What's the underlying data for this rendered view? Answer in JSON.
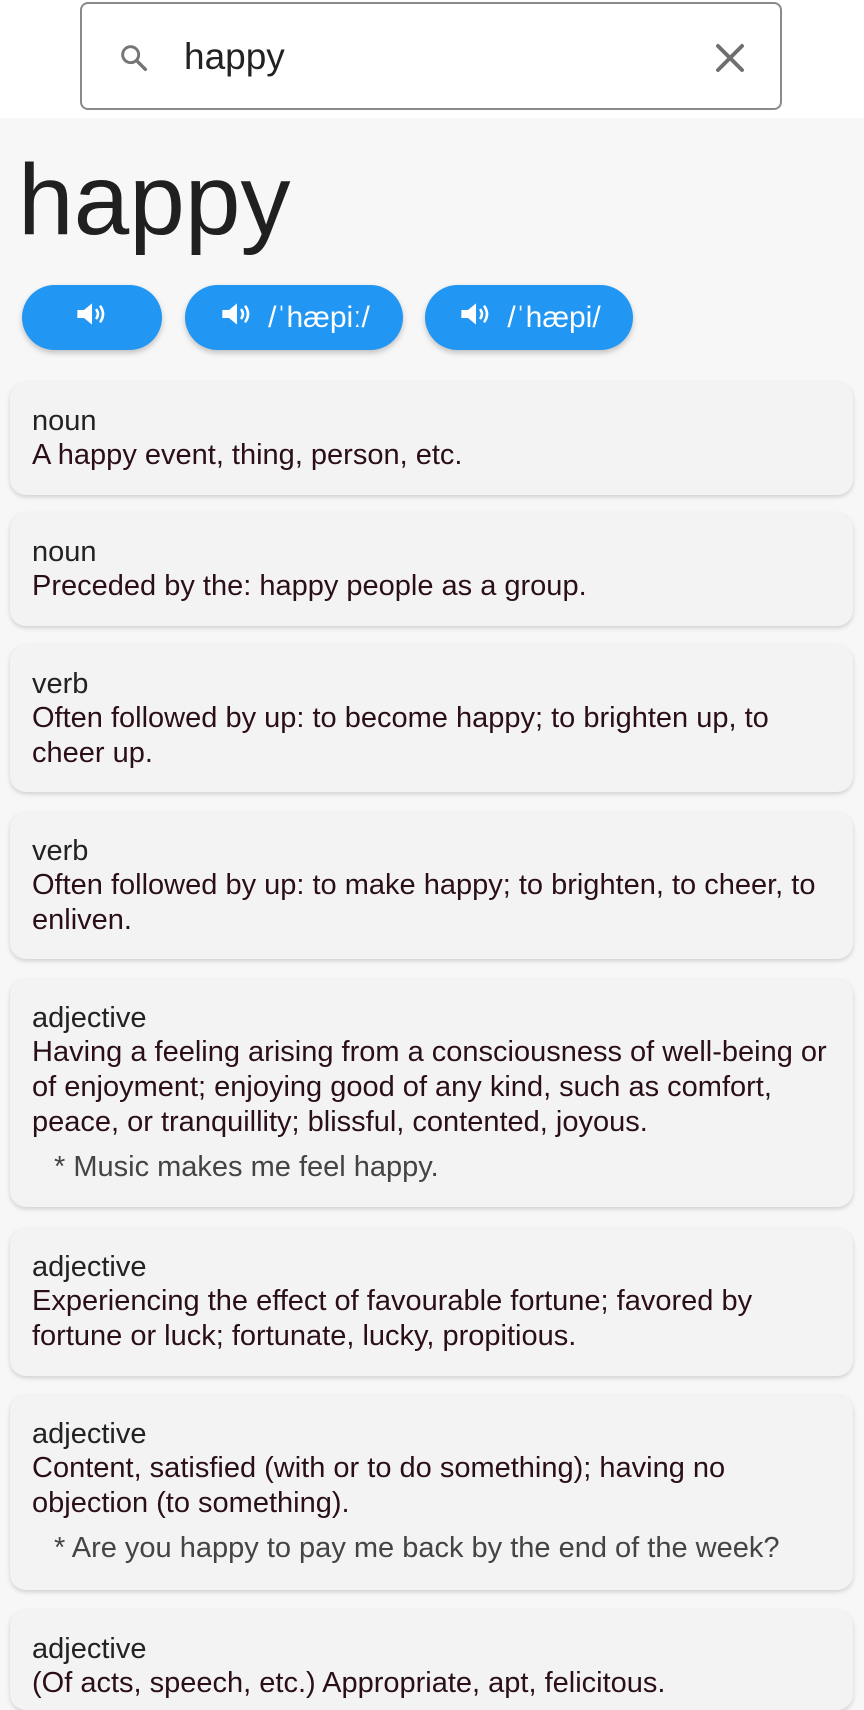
{
  "search": {
    "value": "happy",
    "icon": "search-icon",
    "clear_icon": "close-icon"
  },
  "headword": "happy",
  "audio": [
    {
      "ipa": "",
      "icon": "speaker-icon"
    },
    {
      "ipa": "/ˈhæpiː/",
      "icon": "speaker-icon"
    },
    {
      "ipa": "/ˈhæpi/",
      "icon": "speaker-icon"
    }
  ],
  "colors": {
    "accent": "#2196f3",
    "card_bg": "#f4f3f4",
    "definition_text": "#2a0f16"
  },
  "definitions": [
    {
      "pos": "noun",
      "text": "A happy event, thing, person, etc.",
      "example": ""
    },
    {
      "pos": "noun",
      "text": "Preceded by the: happy people as a group.",
      "example": ""
    },
    {
      "pos": "verb",
      "text": "Often followed by up: to become happy; to brighten up, to cheer up.",
      "example": ""
    },
    {
      "pos": "verb",
      "text": "Often followed by up: to make happy; to brighten, to cheer, to enliven.",
      "example": ""
    },
    {
      "pos": "adjective",
      "text": "Having a feeling arising from a consciousness of well-being or of enjoyment; enjoying good of any kind, such as comfort, peace, or tranquillity; blissful, contented, joyous.",
      "example": "* Music makes me feel happy."
    },
    {
      "pos": "adjective",
      "text": "Experiencing the effect of favourable fortune; favored by fortune or luck; fortunate, lucky, propitious.",
      "example": ""
    },
    {
      "pos": "adjective",
      "text": "Content, satisfied (with or to do something); having no objection (to something).",
      "example": "* Are you happy to pay me back by the end of the week?"
    },
    {
      "pos": "adjective",
      "text": "(Of acts, speech, etc.) Appropriate, apt, felicitous.",
      "example": ""
    }
  ]
}
